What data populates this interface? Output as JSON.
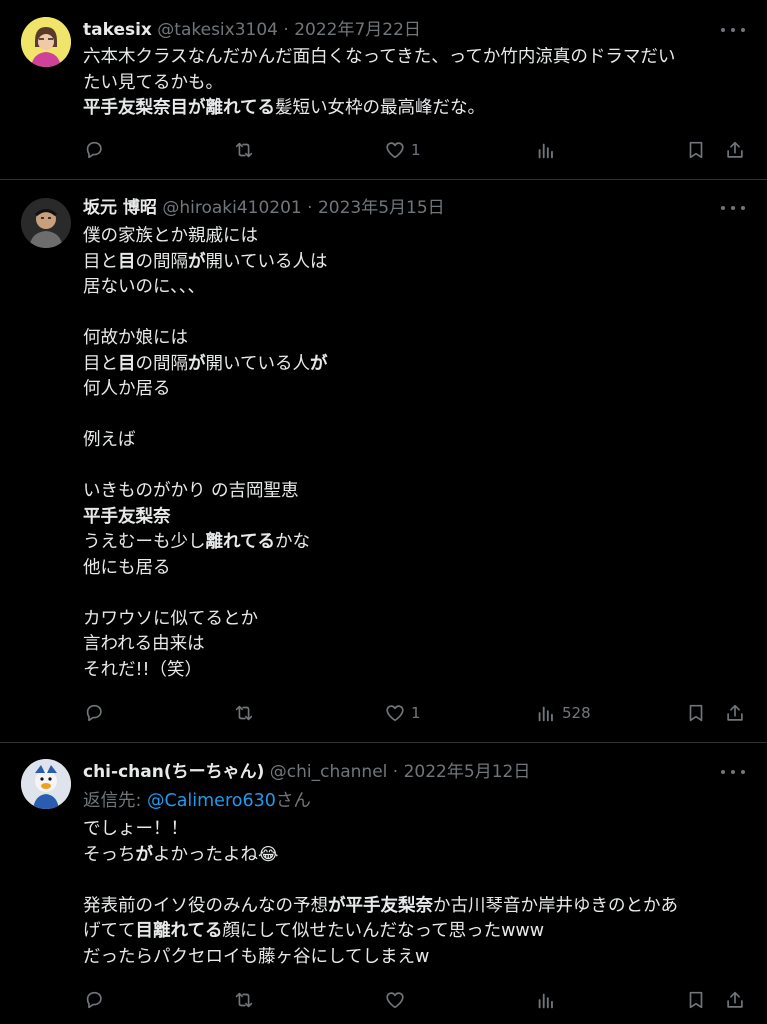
{
  "tweets": [
    {
      "name": "takesix",
      "handle": "@takesix3104",
      "date": "2022年7月22日",
      "lines": [
        [
          {
            "t": "六本木クラスなんだかんだ面白くなってきた、ってか竹内涼真のドラマだい"
          }
        ],
        [
          {
            "t": "たい見てるかも。"
          }
        ],
        [
          {
            "t": "平手友梨奈目が離れてる",
            "b": true
          },
          {
            "t": "髪短い女枠の最高峰だな。"
          }
        ]
      ],
      "actions": {
        "reply": "",
        "retweet": "",
        "like": "1",
        "views": ""
      }
    },
    {
      "name": "坂元 博昭",
      "handle": "@hiroaki410201",
      "date": "2023年5月15日",
      "lines": [
        [
          {
            "t": "僕の家族とか親戚には"
          }
        ],
        [
          {
            "t": "目と"
          },
          {
            "t": "目",
            "b": true
          },
          {
            "t": "の間隔"
          },
          {
            "t": "が",
            "b": true
          },
          {
            "t": "開いている人は"
          }
        ],
        [
          {
            "t": "居ないのに、、、"
          }
        ],
        [],
        [
          {
            "t": "何故か娘には"
          }
        ],
        [
          {
            "t": "目と"
          },
          {
            "t": "目",
            "b": true
          },
          {
            "t": "の間隔"
          },
          {
            "t": "が",
            "b": true
          },
          {
            "t": "開いている人"
          },
          {
            "t": "が",
            "b": true
          }
        ],
        [
          {
            "t": "何人か居る"
          }
        ],
        [],
        [
          {
            "t": "例えば"
          }
        ],
        [],
        [
          {
            "t": "いきものがかり の吉岡聖恵"
          }
        ],
        [
          {
            "t": "平手友梨奈",
            "b": true
          }
        ],
        [
          {
            "t": "うえむーも少し"
          },
          {
            "t": "離れてる",
            "b": true
          },
          {
            "t": "かな"
          }
        ],
        [
          {
            "t": "他にも居る"
          }
        ],
        [],
        [
          {
            "t": "カワウソに似てるとか"
          }
        ],
        [
          {
            "t": "言われる由来は"
          }
        ],
        [
          {
            "t": "それだ!!（笑）"
          }
        ]
      ],
      "actions": {
        "reply": "",
        "retweet": "",
        "like": "1",
        "views": "528"
      }
    },
    {
      "name": "chi-chan(ちーちゃん)",
      "handle": "@chi_channel",
      "date": "2022年5月12日",
      "reply_prefix": "返信先: ",
      "reply_handle": "@Calimero630",
      "reply_suffix": "さん",
      "lines": [
        [
          {
            "t": "でしょー！！"
          }
        ],
        [
          {
            "t": "そっち"
          },
          {
            "t": "が",
            "b": true
          },
          {
            "t": "よかったよね😂"
          }
        ],
        [],
        [
          {
            "t": "発表前のイソ役のみんなの予想"
          },
          {
            "t": "が平手友梨奈",
            "b": true
          },
          {
            "t": "か古川琴音か岸井ゆきのとかあ"
          }
        ],
        [
          {
            "t": "げてて"
          },
          {
            "t": "目離れてる",
            "b": true
          },
          {
            "t": "顔にして似せたいんだなって思ったwww"
          }
        ],
        [
          {
            "t": "だったらパクセロイも藤ヶ谷にしてしまえw"
          }
        ]
      ],
      "actions": {
        "reply": "",
        "retweet": "",
        "like": "",
        "views": ""
      }
    }
  ],
  "icons": {
    "reply": "reply-icon",
    "retweet": "retweet-icon",
    "like": "heart-icon",
    "views": "views-icon",
    "bookmark": "bookmark-icon",
    "share": "share-icon",
    "more": "more-icon"
  },
  "colors": {
    "background": "#000000",
    "text": "#e7e9ea",
    "muted": "#71767b",
    "link": "#1d9bf0",
    "divider": "#2f3336"
  }
}
